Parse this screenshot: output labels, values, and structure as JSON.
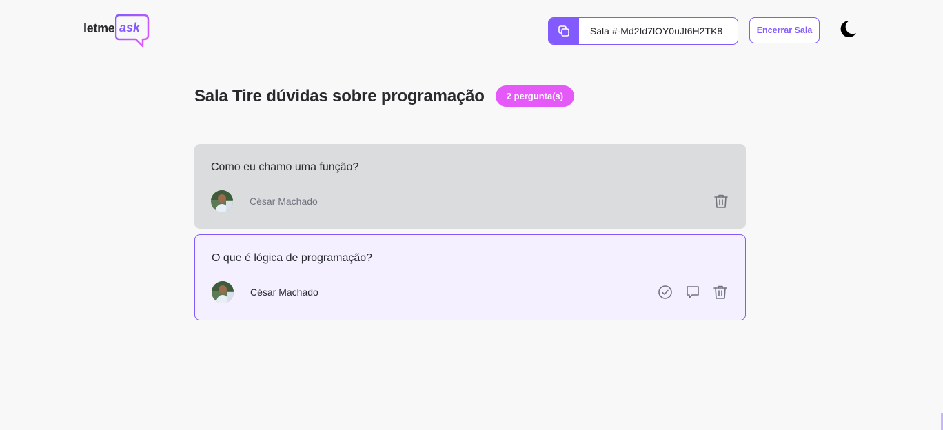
{
  "header": {
    "logo": {
      "text_main": "letme",
      "text_accent": "ask"
    },
    "room_code": {
      "label": "Sala #-Md2Id7lOY0uJt6H2TK8"
    },
    "close_room_label": "Encerrar Sala",
    "theme_toggle_icon": "moon-icon"
  },
  "room": {
    "title": "Sala Tire dúvidas sobre programação",
    "question_count": "2 pergunta(s)"
  },
  "questions": [
    {
      "content": "Como eu chamo uma função?",
      "author": "César Machado",
      "state": "answered",
      "actions": [
        "trash-icon"
      ]
    },
    {
      "content": "O que é lógica de programação?",
      "author": "César Machado",
      "state": "highlighted",
      "actions": [
        "check-circle-icon",
        "message-icon",
        "trash-icon"
      ]
    }
  ],
  "colors": {
    "accent": "#835afd",
    "badge": "#e559f9",
    "answered_bg": "#dbdcdd",
    "highlighted_bg": "#f4f0ff"
  }
}
